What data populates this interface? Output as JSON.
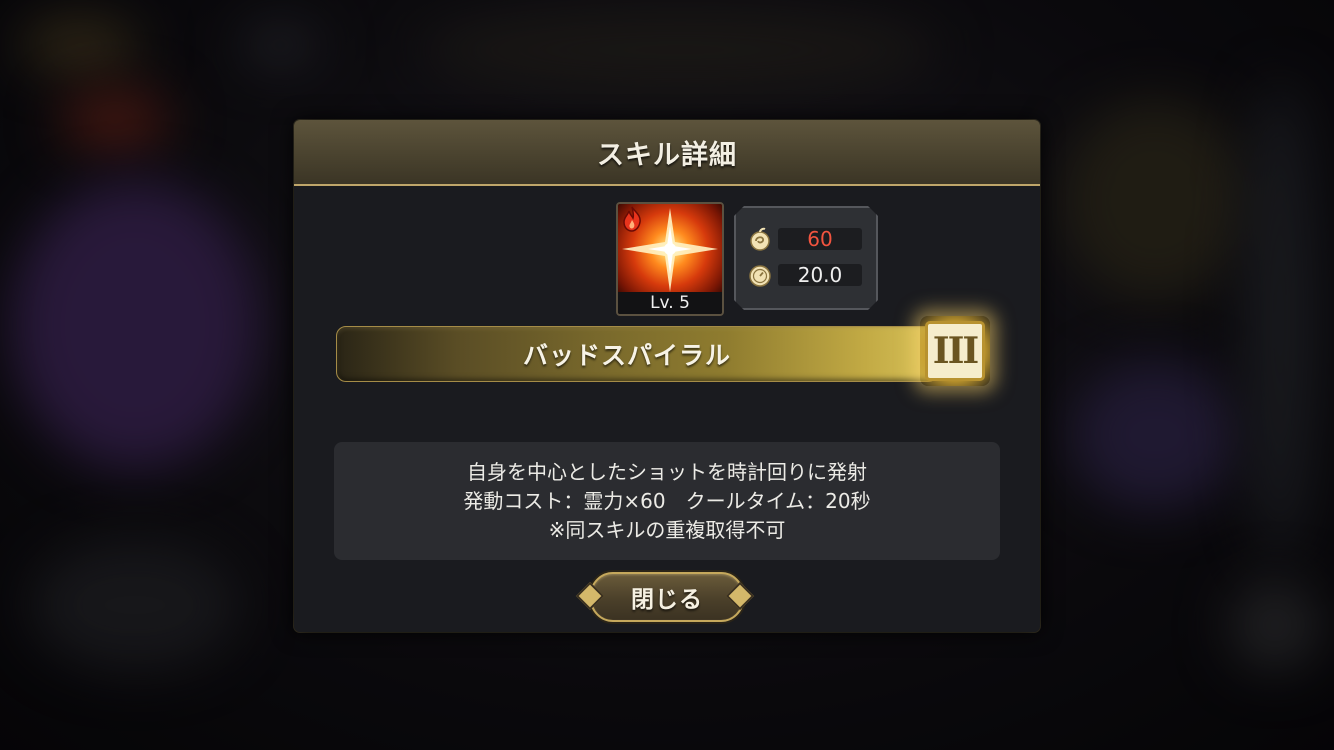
{
  "dialog": {
    "title": "スキル詳細",
    "skill": {
      "element_icon": "fire-icon",
      "level_label": "Lv. 5",
      "name": "バッドスパイラル",
      "rank": "III",
      "cost_icon": "spirit-orb-icon",
      "cost_value": "60",
      "cooldown_icon": "stopwatch-icon",
      "cooldown_value": "20.0"
    },
    "description": {
      "line1": "自身を中心としたショットを時計回りに発射",
      "line2": "発動コスト：霊力×60　クールタイム：20秒",
      "line3": "※同スキルの重複取得不可"
    },
    "close_label": "閉じる"
  },
  "colors": {
    "header": "#4a432f",
    "accent_gold": "#c5a85c",
    "cost_red": "#f2543f",
    "panel": "#1a1b1f"
  }
}
